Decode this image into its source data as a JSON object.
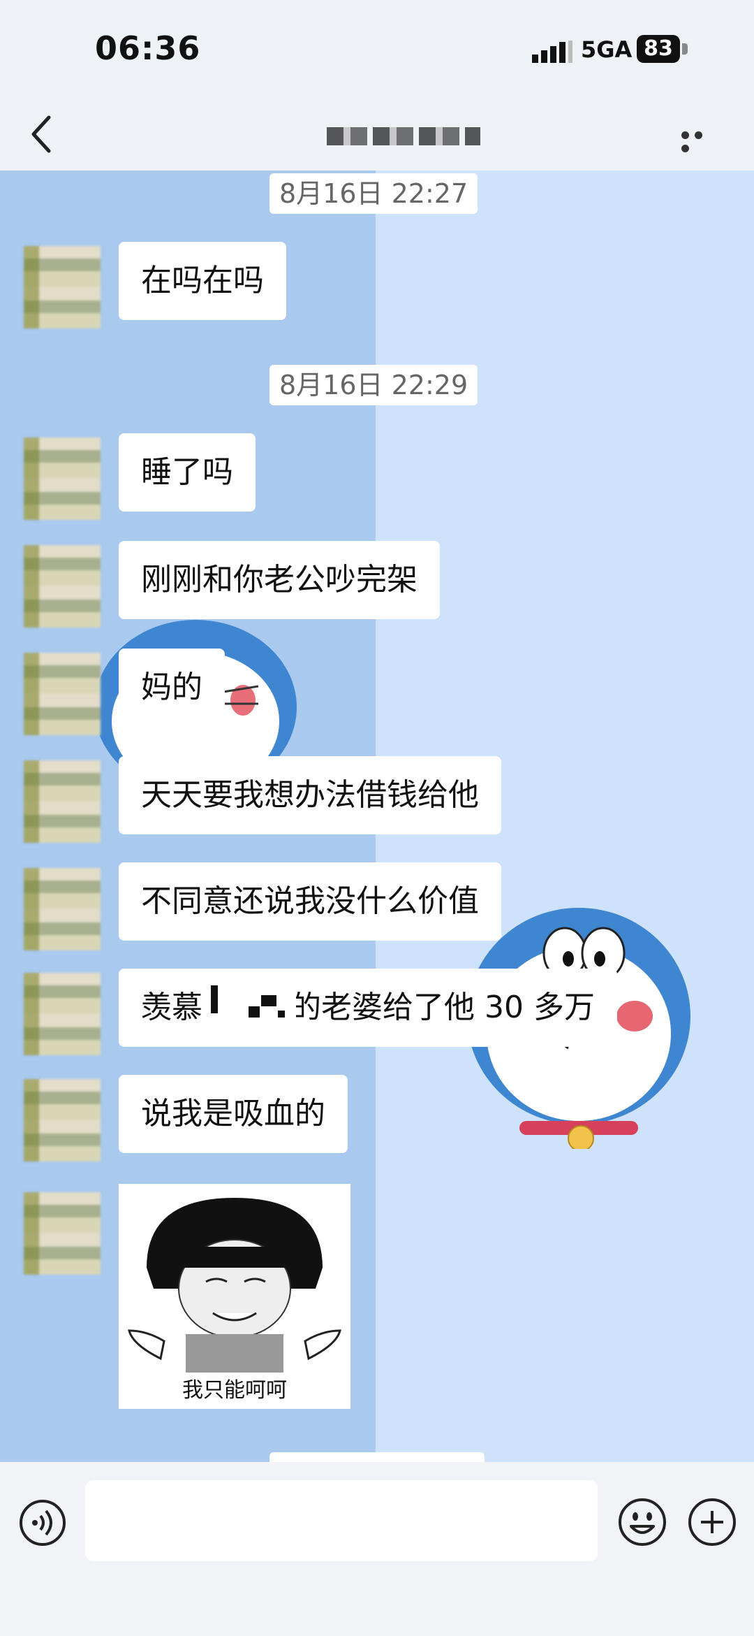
{
  "status_bar": {
    "time": "06:36",
    "network": "5GA",
    "battery": "83"
  },
  "header": {
    "back_icon": "chevron-left-icon",
    "more_icon": "ellipsis-icon"
  },
  "messages": [
    {
      "type": "timestamp",
      "text": "8月16日 22:27"
    },
    {
      "type": "text",
      "text": "在吗在吗"
    },
    {
      "type": "timestamp",
      "text": "8月16日 22:29"
    },
    {
      "type": "text",
      "text": "睡了吗"
    },
    {
      "type": "text",
      "text": "刚刚和你老公吵完架"
    },
    {
      "type": "text",
      "text": "妈的"
    },
    {
      "type": "text",
      "text": "天天要我想办法借钱给他"
    },
    {
      "type": "text",
      "text": "不同意还说我没什么价值"
    },
    {
      "type": "text",
      "text": "羡慕",
      "text_after": "的老婆给了他 30 多万"
    },
    {
      "type": "text",
      "text": "说我是吸血的"
    },
    {
      "type": "sticker",
      "caption": "我只能呵呵"
    }
  ],
  "input_bar": {
    "voice_icon": "voice-icon",
    "emoji_icon": "emoji-icon",
    "plus_icon": "plus-icon"
  },
  "colors": {
    "chat_bg_left": "#a9c9ef",
    "chat_bg_right": "#cfe2fb",
    "bubble": "#ffffff"
  }
}
